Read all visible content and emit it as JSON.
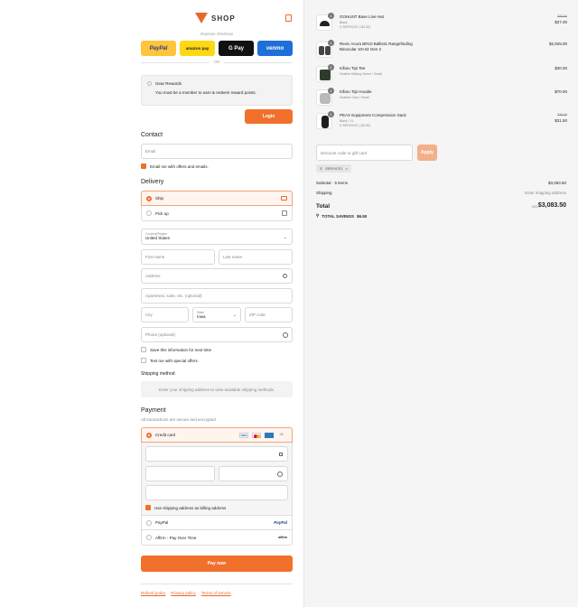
{
  "header": {
    "brand": "SHOP"
  },
  "express": {
    "title": "Express checkout",
    "buttons": [
      {
        "label": "PayPal",
        "bg": "#ffc43a",
        "fg": "#1f3b8c"
      },
      {
        "label": "amazon pay",
        "bg": "#ffd814",
        "fg": "#222"
      },
      {
        "label": "G Pay",
        "bg": "#111111",
        "fg": "#ffffff"
      },
      {
        "label": "venmo",
        "bg": "#1f6fd9",
        "fg": "#ffffff"
      }
    ],
    "or": "OR"
  },
  "rewards": {
    "title": "Gear Rewards",
    "message": "You must be a member to earn & redeem reward points.",
    "login": "Login"
  },
  "contact": {
    "title": "Contact",
    "email_placeholder": "Email",
    "email_offers": "Email me with offers and emails."
  },
  "delivery": {
    "title": "Delivery",
    "ship": "Ship",
    "pickup": "Pick up",
    "country_label": "Country/Region",
    "country_value": "United States",
    "first_name": "First name",
    "last_name": "Last name",
    "address": "Address",
    "apartment": "Apartment, suite, etc. (optional)",
    "city": "City",
    "state_label": "State",
    "state_value": "Iowa",
    "zip": "ZIP code",
    "phone": "Phone (optional)",
    "save_info": "Save this information for next time",
    "text_offers": "Text me with special offers."
  },
  "shipping_method": {
    "title": "Shipping method",
    "message": "Enter your shipping address to view available shipping methods."
  },
  "payment": {
    "title": "Payment",
    "subtitle": "All transactions are secure and encrypted.",
    "credit_card": "Credit card",
    "more_cards": "+6",
    "use_shipping": "Use shipping address as billing address",
    "paypal": "PayPal",
    "paypal_logo": "PayPal",
    "affirm": "Affirm - Pay Over Time",
    "affirm_logo": "affirm",
    "pay_now": "Pay now"
  },
  "footer": {
    "links": [
      "Refund policy",
      "Privacy policy",
      "Terms of service"
    ]
  },
  "cart": {
    "items": [
      {
        "name": "GOHUNT Base Line Hat",
        "variant": "Black",
        "discount": "SERVICE1 (-$3.00)",
        "orig": "$30.00",
        "price": "$27.00",
        "qty": "1"
      },
      {
        "name": "Revic Acura BR10 Ballistic Rangefinding Binocular 10×42 Gen 2",
        "variant": "",
        "discount": "",
        "orig": "",
        "price": "$2,925.00",
        "qty": "1"
      },
      {
        "name": "Kifaru Tipi Tee",
        "variant": "Heather Military Green / Small",
        "discount": "",
        "orig": "",
        "price": "$30.00",
        "qty": "1"
      },
      {
        "name": "Kifaru Tipi Hoodie",
        "variant": "Heather Grey / Small",
        "discount": "",
        "orig": "",
        "price": "$70.00",
        "qty": "1"
      },
      {
        "name": "PEAX Equipment Compression Sack",
        "variant": "Black / XL",
        "discount": "SERVICE1 (-$3.50)",
        "orig": "$35.00",
        "price": "$31.50",
        "qty": "1"
      }
    ],
    "discount_placeholder": "Discount code or gift card",
    "apply": "Apply",
    "code_tag": "SERVICE1",
    "subtotal_label": "Subtotal · 5 items",
    "subtotal": "$3,083.50",
    "shipping_label": "Shipping",
    "shipping_value": "Enter shipping address",
    "total_label": "Total",
    "currency": "USD",
    "total": "$3,083.50",
    "savings_label": "TOTAL SAVINGS",
    "savings": "$6.50"
  },
  "colors": {
    "accent": "#f0702c"
  }
}
